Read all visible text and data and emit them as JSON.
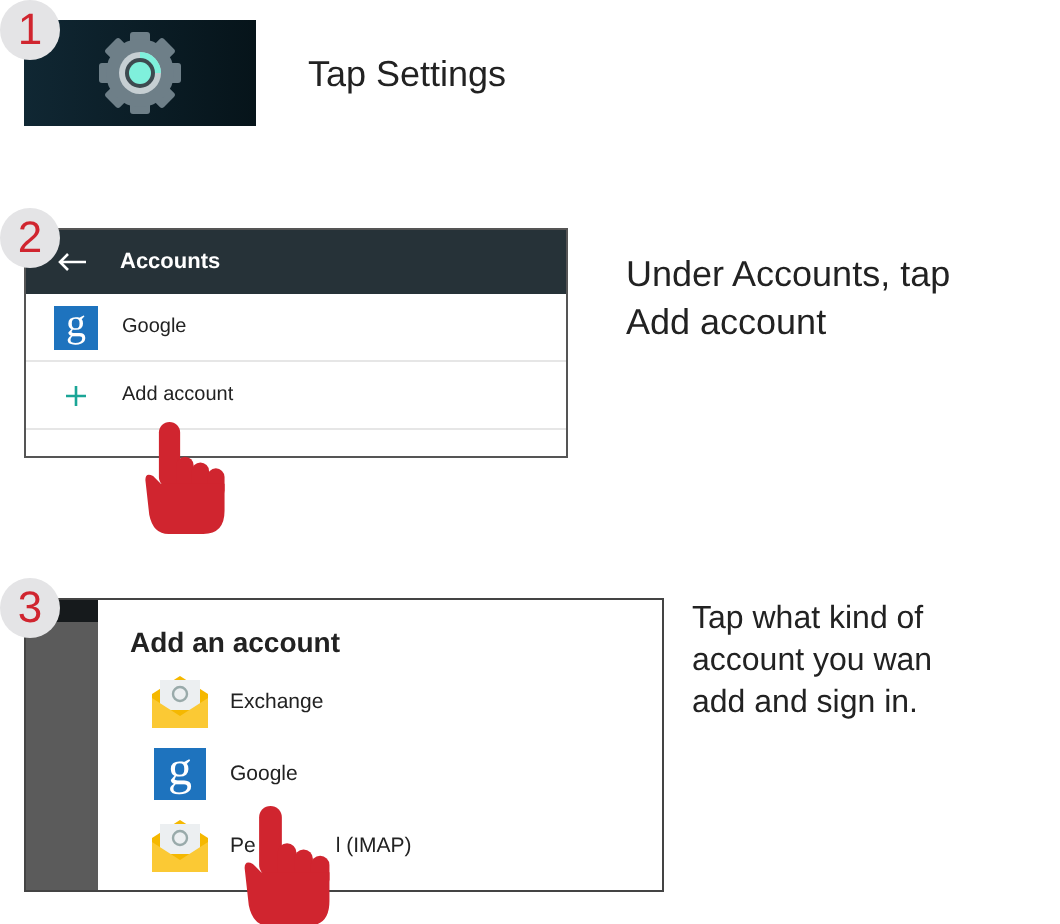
{
  "steps": [
    {
      "number": "1",
      "kind": "settings",
      "caption": "Tap Settings"
    },
    {
      "number": "2",
      "kind": "accounts",
      "header": "Accounts",
      "caption": "Under Accounts, tap\nAdd account",
      "items": [
        {
          "kind": "google",
          "logo": "g",
          "label": "Google"
        },
        {
          "kind": "add",
          "label": "Add account"
        }
      ]
    },
    {
      "number": "3",
      "kind": "dialog",
      "title": "Add an account",
      "caption": "Tap what kind of\naccount you wan\nadd and sign in.",
      "items": [
        {
          "kind": "email",
          "label": "Exchange"
        },
        {
          "kind": "google",
          "logo": "g",
          "label": "Google"
        },
        {
          "kind": "email",
          "label_fragments": [
            "Pe",
            "l (IMAP)"
          ]
        }
      ]
    }
  ]
}
